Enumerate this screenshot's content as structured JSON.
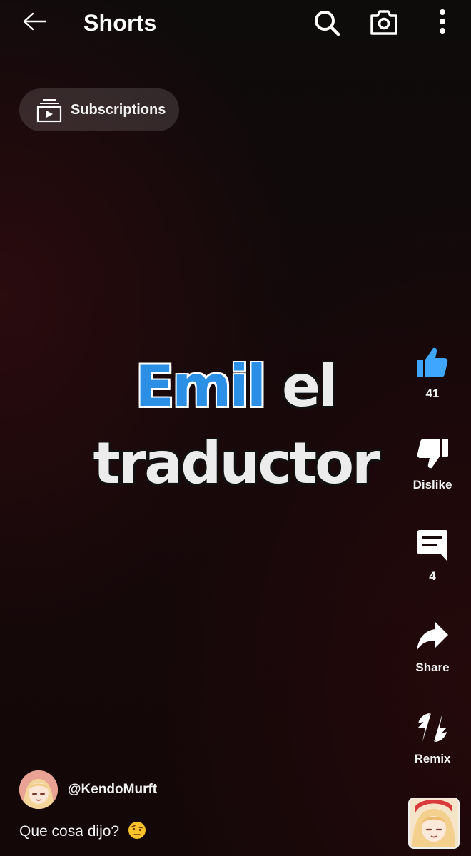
{
  "header": {
    "title": "Shorts",
    "back_icon": "arrow-left-icon",
    "search_icon": "search-icon",
    "camera_icon": "camera-icon",
    "more_icon": "more-vertical-icon"
  },
  "subscriptions_chip": {
    "label": "Subscriptions",
    "icon": "subscriptions-icon"
  },
  "video": {
    "caption_line1_highlight": "Emil",
    "caption_line1_rest": " el",
    "caption_line2": "traductor",
    "highlight_color": "#2b8fe6"
  },
  "actions": {
    "like": {
      "label": "41",
      "icon": "thumbs-up-icon",
      "active": true,
      "color": "#3ea6ff"
    },
    "dislike": {
      "label": "Dislike",
      "icon": "thumbs-down-icon"
    },
    "comments": {
      "label": "4",
      "icon": "comment-icon"
    },
    "share": {
      "label": "Share",
      "icon": "share-icon"
    },
    "remix": {
      "label": "Remix",
      "icon": "remix-icon"
    }
  },
  "channel": {
    "handle": "@KendoMurft",
    "avatar": "avatar-anime-girl"
  },
  "description": {
    "text": "Que cosa dijo?",
    "emoji": "face-with-raised-eyebrow-emoji"
  },
  "sound_thumbnail": "audio-thumbnail-anime-girl"
}
